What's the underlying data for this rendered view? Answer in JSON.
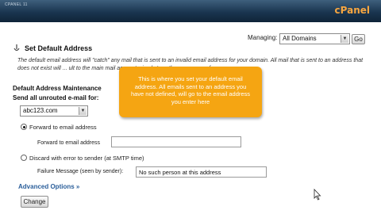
{
  "header": {
    "crumb": "CPANEL 11",
    "brand": "cPanel"
  },
  "managing": {
    "label": "Managing:",
    "selected": "All Domains",
    "go_label": "Go"
  },
  "section": {
    "title": "Set Default Address",
    "description": "The default email address will \"catch\" any mail that is sent to an invalid email address for your domain. All mail that is sent to an address that does not exist will ... ult to the main mail account, simply type the user name of your ..."
  },
  "form": {
    "maintenance_heading": "Default Address Maintenance",
    "send_all_label": "Send all unrouted e-mail for:",
    "domain_selected": "abc123.com",
    "forward_option": "Forward to email address",
    "forward_field_label": "Forward to email address",
    "forward_value": "",
    "discard_option": "Discard with error to sender (at SMTP time)",
    "failure_field_label": "Failure Message (seen by sender):",
    "failure_value": "No such person at this address",
    "advanced_label": "Advanced Options »",
    "change_label": "Change"
  },
  "tooltip": {
    "text": "This is where you set your default email address. All emails sent to an address you have not defined, will go to the email address you enter here"
  },
  "colors": {
    "header": "#1a3550",
    "brand": "#f7a640",
    "tooltip": "#f5a512",
    "link": "#2a5e9a"
  },
  "icons": {
    "section": "mail-icon",
    "cursor": "mouse-pointer-icon"
  }
}
